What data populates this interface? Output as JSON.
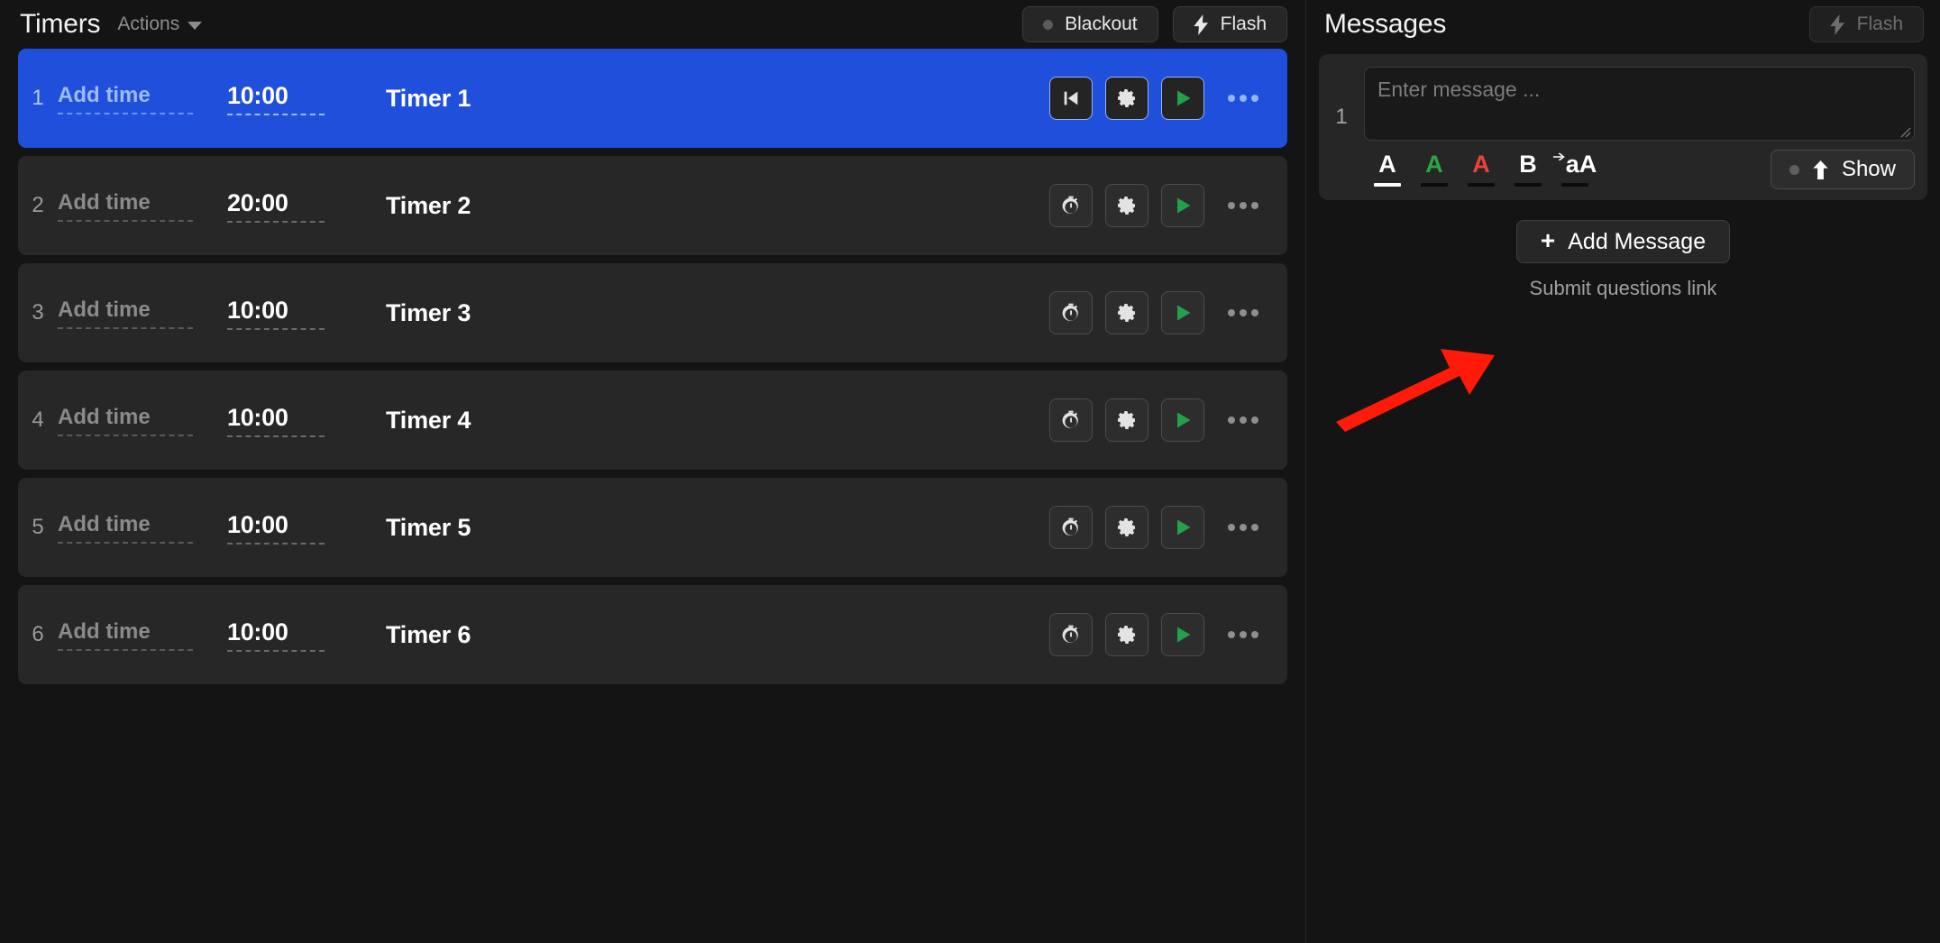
{
  "timers": {
    "title": "Timers",
    "actions_label": "Actions",
    "blackout_label": "Blackout",
    "flash_label": "Flash",
    "columns": [
      "index",
      "add_time",
      "time",
      "name"
    ],
    "add_time_label": "Add time",
    "rows": [
      {
        "index": "1",
        "add_time": "Add time",
        "time": "10:00",
        "name": "Timer 1",
        "active": true,
        "left_icon": "rewind-to-start-icon"
      },
      {
        "index": "2",
        "add_time": "Add time",
        "time": "20:00",
        "name": "Timer 2",
        "active": false,
        "left_icon": "stopwatch-icon"
      },
      {
        "index": "3",
        "add_time": "Add time",
        "time": "10:00",
        "name": "Timer 3",
        "active": false,
        "left_icon": "stopwatch-icon"
      },
      {
        "index": "4",
        "add_time": "Add time",
        "time": "10:00",
        "name": "Timer 4",
        "active": false,
        "left_icon": "stopwatch-icon"
      },
      {
        "index": "5",
        "add_time": "Add time",
        "time": "10:00",
        "name": "Timer 5",
        "active": false,
        "left_icon": "stopwatch-icon"
      },
      {
        "index": "6",
        "add_time": "Add time",
        "time": "10:00",
        "name": "Timer 6",
        "active": false,
        "left_icon": "stopwatch-icon"
      }
    ],
    "row_icons": {
      "settings": "gear-icon",
      "play": "play-icon",
      "more": "more-horizontal-icon"
    }
  },
  "messages": {
    "title": "Messages",
    "flash_label": "Flash",
    "flash_disabled": true,
    "message": {
      "index": "1",
      "value": "",
      "placeholder": "Enter message ..."
    },
    "toolbar": [
      {
        "glyph": "A",
        "name": "text-color-white-button",
        "color": "#ffffff",
        "selected": true
      },
      {
        "glyph": "A",
        "name": "text-color-green-button",
        "color": "#28a745",
        "selected": false
      },
      {
        "glyph": "A",
        "name": "text-color-red-button",
        "color": "#e8453c",
        "selected": false
      },
      {
        "glyph": "B",
        "name": "bold-button",
        "color": "#ffffff",
        "selected": false
      },
      {
        "glyph": "aA",
        "name": "text-case-button",
        "color": "#ffffff",
        "selected": false
      }
    ],
    "show_label": "Show",
    "add_message_label": "Add Message",
    "add_message_plus": "+",
    "submit_link_label": "Submit questions link"
  },
  "colors": {
    "page_bg": "#141414",
    "row_bg": "#272727",
    "active_row": "#1f4fdb",
    "play_green": "#22a14a",
    "annotation_red": "#ff1a09",
    "muted_text": "#8d8d8d"
  }
}
